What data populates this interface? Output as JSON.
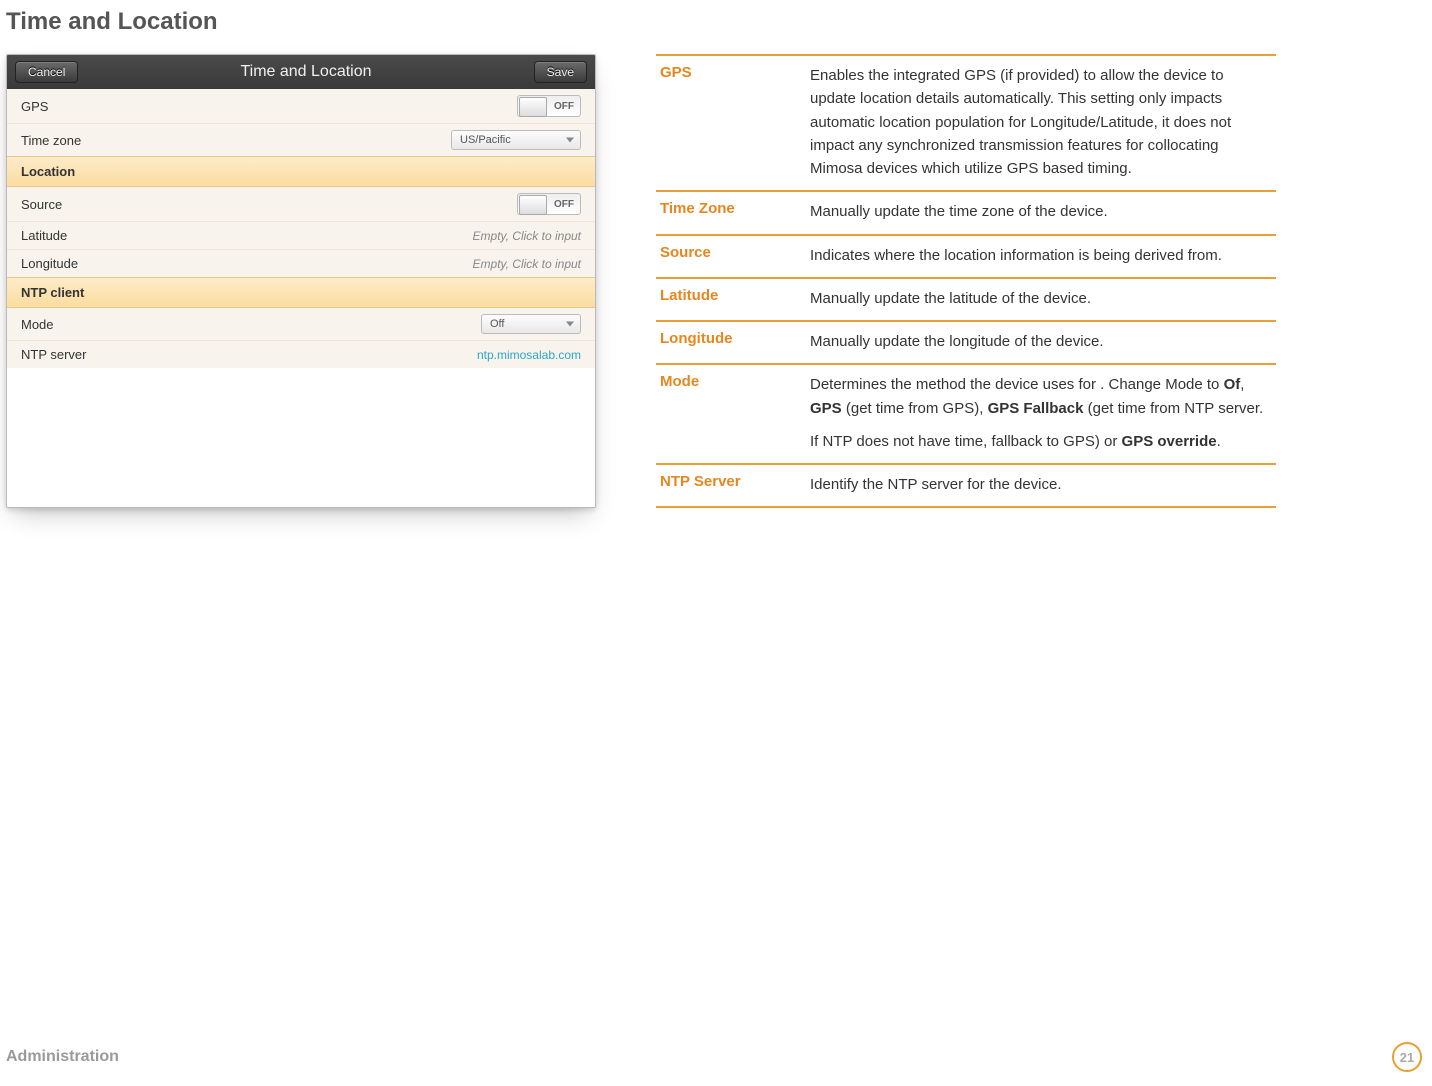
{
  "page": {
    "title": "Time and Location",
    "footer_section": "Administration",
    "page_number": "21"
  },
  "panel": {
    "cancel": "Cancel",
    "save": "Save",
    "title": "Time and Location",
    "rows": {
      "gps_label": "GPS",
      "gps_toggle": "OFF",
      "tz_label": "Time zone",
      "tz_value": "US/Pacific",
      "location_header": "Location",
      "source_label": "Source",
      "source_toggle": "OFF",
      "lat_label": "Latitude",
      "lat_placeholder": "Empty, Click to input",
      "lon_label": "Longitude",
      "lon_placeholder": "Empty, Click to input",
      "ntp_header": "NTP client",
      "mode_label": "Mode",
      "mode_value": "Off",
      "ntp_label": "NTP server",
      "ntp_value": "ntp.mimosalab.com"
    }
  },
  "defs": {
    "gps": {
      "term": "GPS",
      "desc": "Enables the integrated GPS (if provided) to allow the device to update location details automatically. This setting only impacts automatic location population for Longitude/Latitude, it does not impact any synchronized transmission features for collocating Mimosa devices which utilize GPS based timing."
    },
    "tz": {
      "term": "Time Zone",
      "desc": "Manually update the time zone of the device."
    },
    "source": {
      "term": "Source",
      "desc": "Indicates where the location information is being derived from."
    },
    "lat": {
      "term": "Latitude",
      "desc": "Manually update the latitude of the device."
    },
    "lon": {
      "term": "Longitude",
      "desc": "Manually update the longitude of the device."
    },
    "mode": {
      "term": "Mode",
      "p1_a": "Determines the method the device uses for . Change Mode to ",
      "p1_b": "Of",
      "p1_c": ", ",
      "p1_d": "GPS",
      "p1_e": " (get time from GPS), ",
      "p1_f": "GPS Fallback",
      "p1_g": " (get time from NTP server.",
      "p2_a": "If NTP does not have time, fallback to GPS) or ",
      "p2_b": "GPS override",
      "p2_c": "."
    },
    "ntp": {
      "term": "NTP Server",
      "desc": "Identify the NTP server for the device."
    }
  }
}
